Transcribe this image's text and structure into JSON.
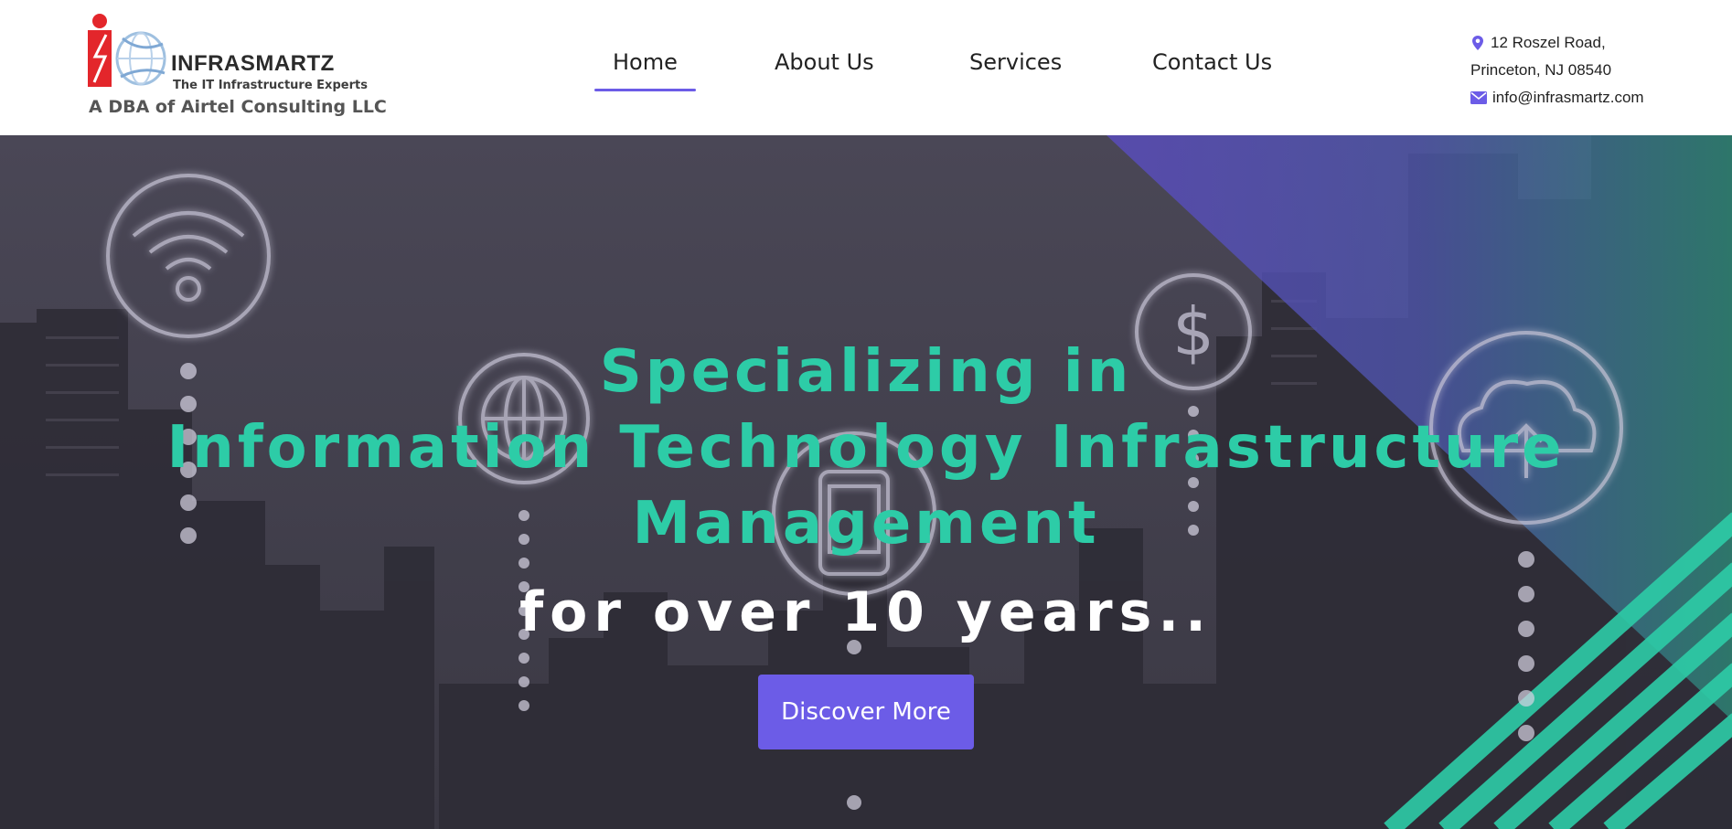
{
  "header": {
    "logo": {
      "name": "INFRASMARTZ",
      "tagline": "The IT Infrastructure Experts",
      "dba": "A DBA of Airtel Consulting LLC"
    },
    "nav": {
      "items": [
        {
          "label": "Home",
          "active": true
        },
        {
          "label": "About Us",
          "active": false
        },
        {
          "label": "Services",
          "active": false
        },
        {
          "label": "Contact Us",
          "active": false
        }
      ]
    },
    "contact": {
      "address_line1": "12 Roszel Road,",
      "address_line2": "Princeton, NJ 08540",
      "email": "info@infrasmartz.com",
      "address_icon": "map-marker-icon",
      "email_icon": "envelope-icon"
    }
  },
  "hero": {
    "heading_line1": "Specializing in",
    "heading_line2": "Information Technology Infrastructure",
    "heading_line3": "Management",
    "subheading": "for over 10 years..",
    "cta_label": "Discover More",
    "background_icons": [
      "wifi-icon",
      "globe-icon",
      "smartphone-icon",
      "dollar-icon",
      "cloud-upload-icon"
    ]
  },
  "colors": {
    "accent": "#6c5ce7",
    "heading_green": "#2dcca7",
    "hero_overlay": "#45424f",
    "white": "#ffffff"
  }
}
